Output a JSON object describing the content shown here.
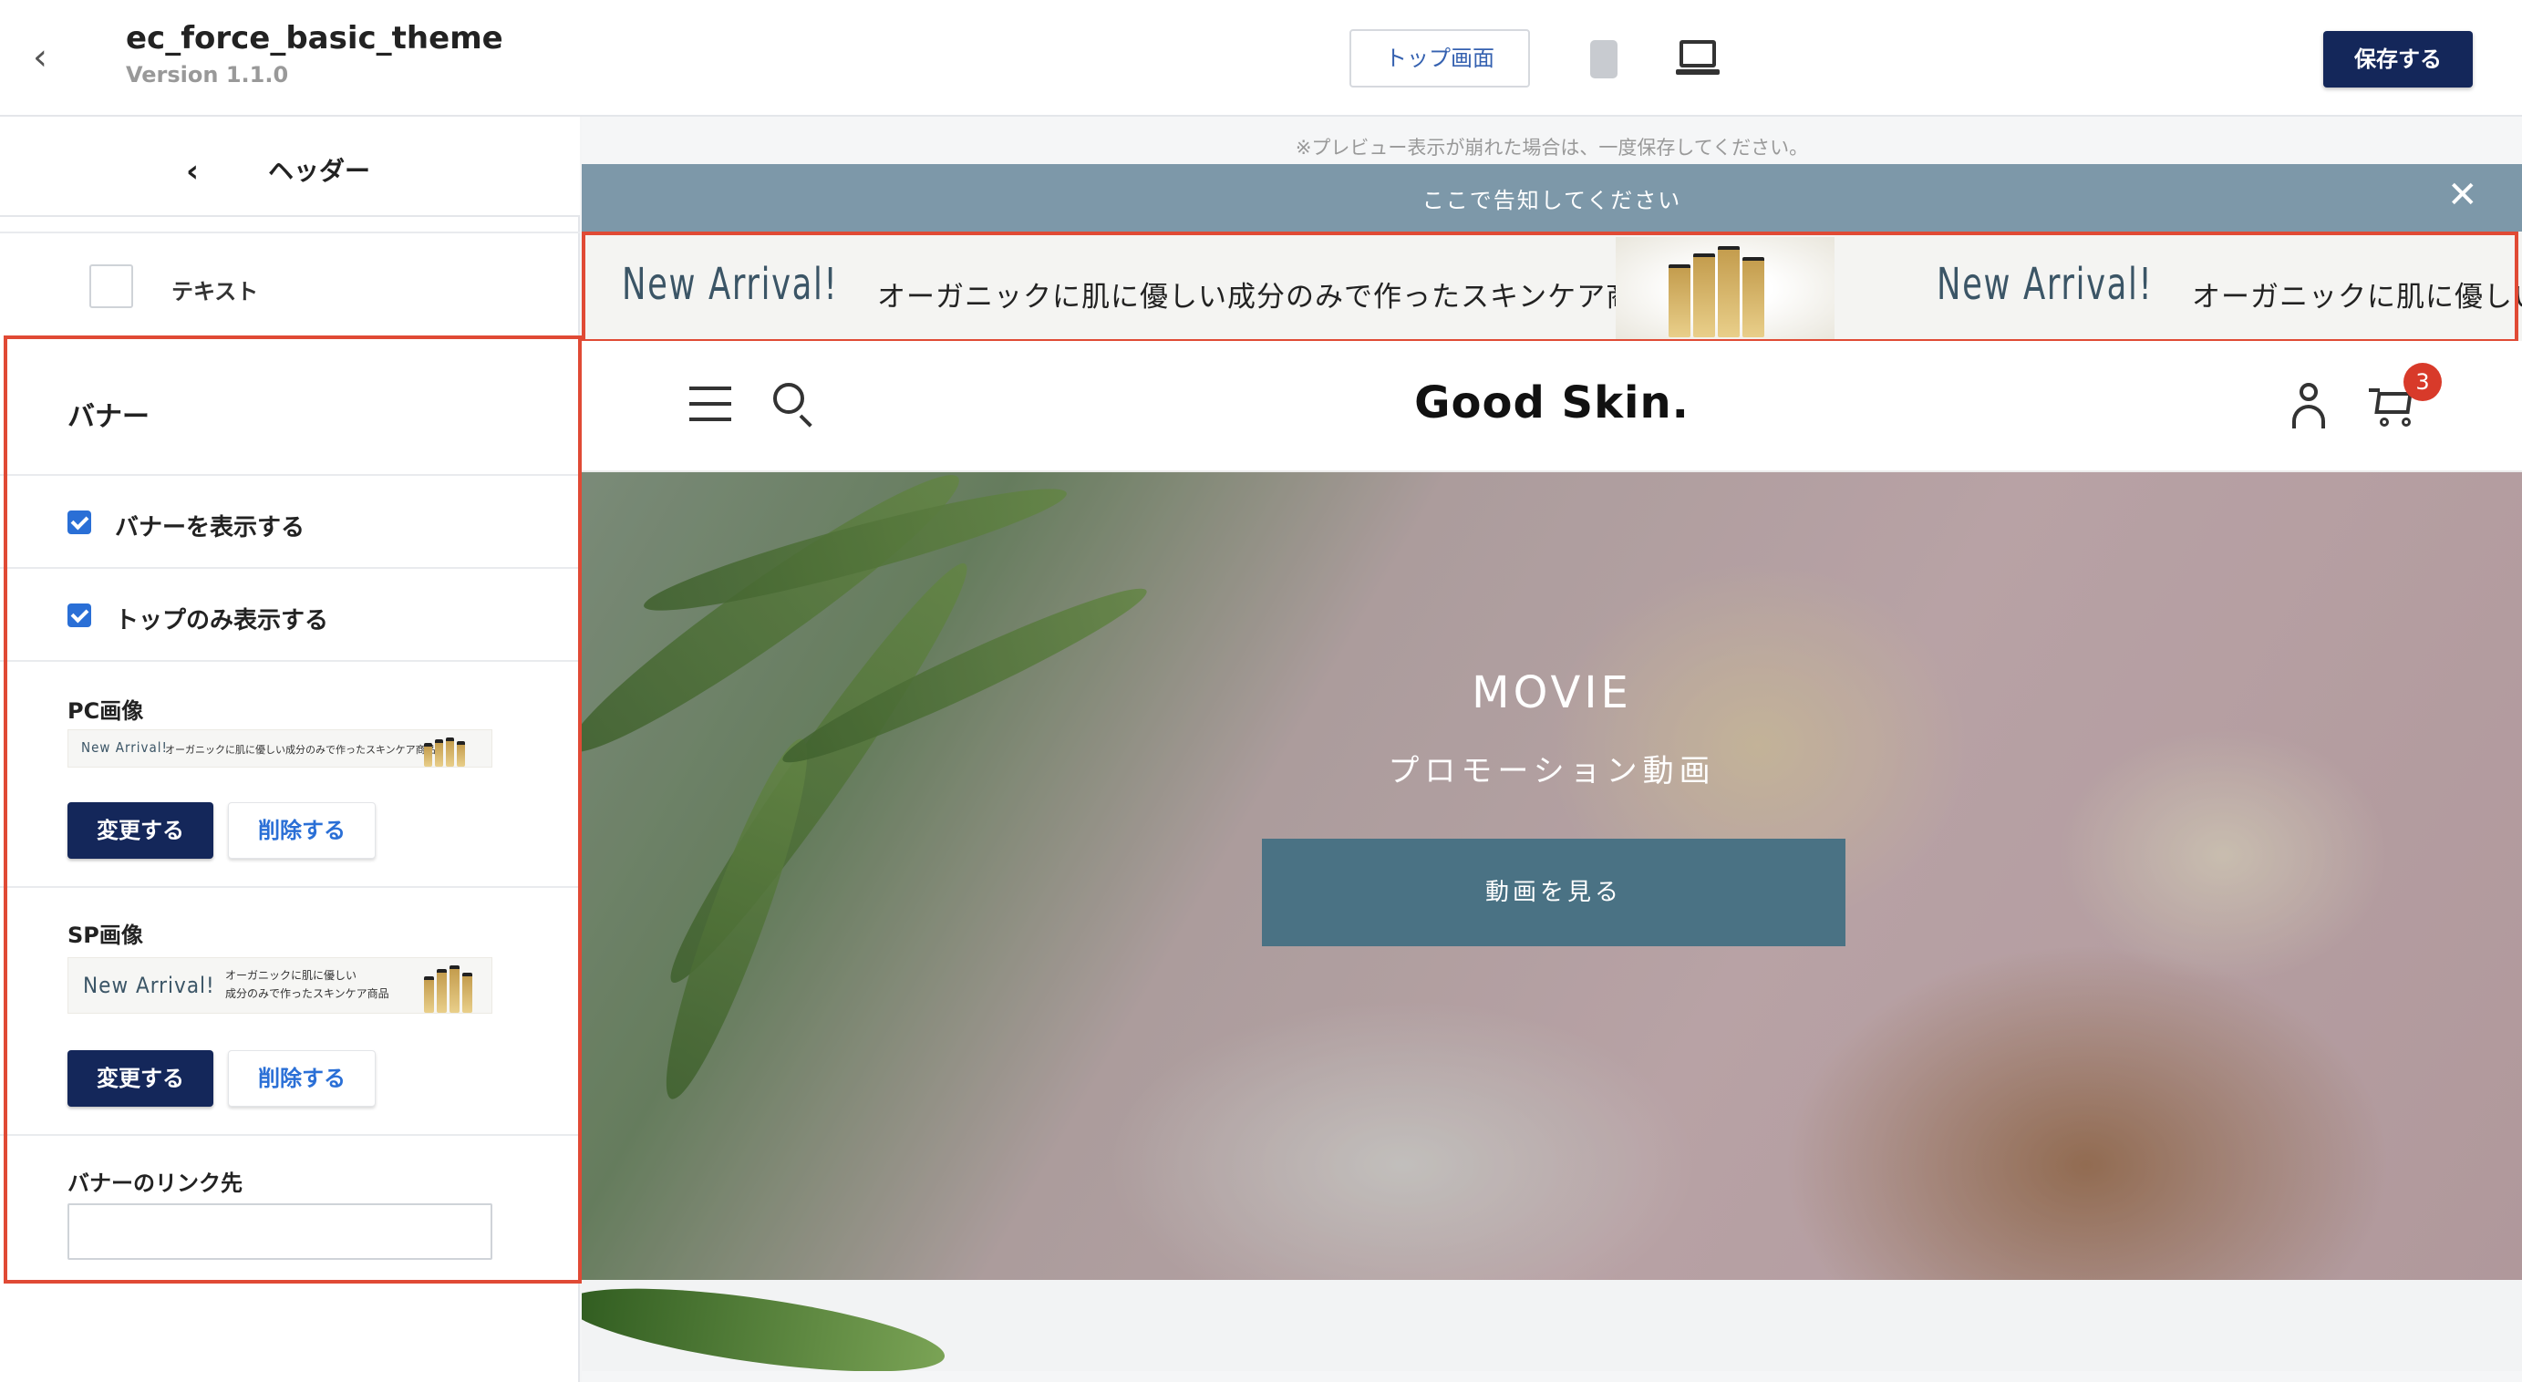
{
  "app": {
    "theme_name": "ec_force_basic_theme",
    "version": "Version 1.1.0",
    "back_glyph": "‹",
    "top_screen_button": "トップ画面",
    "save_button": "保存する"
  },
  "sidebar": {
    "section_back_glyph": "‹",
    "section_title": "ヘッダー",
    "text_option_label": "テキスト",
    "banner": {
      "title": "バナー",
      "show_banner_label": "バナーを表示する",
      "show_banner_checked": true,
      "top_only_label": "トップのみ表示する",
      "top_only_checked": true,
      "pc_image_label": "PC画像",
      "pc_thumb_title": "New Arrival!",
      "pc_thumb_text": "オーガニックに肌に優しい成分のみで作ったスキンケア商品",
      "sp_image_label": "SP画像",
      "sp_thumb_title": "New Arrival!",
      "sp_thumb_line1": "オーガニックに肌に優しい",
      "sp_thumb_line2": "成分のみで作ったスキンケア商品",
      "change_button": "変更する",
      "delete_button": "削除する",
      "link_label": "バナーのリンク先",
      "link_value": ""
    }
  },
  "preview": {
    "note": "※プレビュー表示が崩れた場合は、一度保存してください。",
    "announcement": "ここで告知してください",
    "close_glyph": "✕",
    "promo": {
      "title": "New Arrival!",
      "text": "オーガニックに肌に優しい成分のみで作ったスキンケア商品",
      "text_cut": "オーガニックに肌に優しい"
    },
    "logo": "Good Skin.",
    "cart_count": "3",
    "hero": {
      "title": "MOVIE",
      "subtitle": "プロモーション動画",
      "button": "動画を見る"
    }
  },
  "colors": {
    "primary_button": "#14275a",
    "link_blue": "#2a6fd6",
    "announce_bar": "#7d98a9",
    "highlight": "#e04a35",
    "hero_button": "#4a7284",
    "badge": "#d83a2a"
  },
  "icons": [
    "back-arrow-icon",
    "phone-icon",
    "laptop-icon",
    "hamburger-icon",
    "search-icon",
    "user-icon",
    "cart-icon",
    "close-icon"
  ]
}
